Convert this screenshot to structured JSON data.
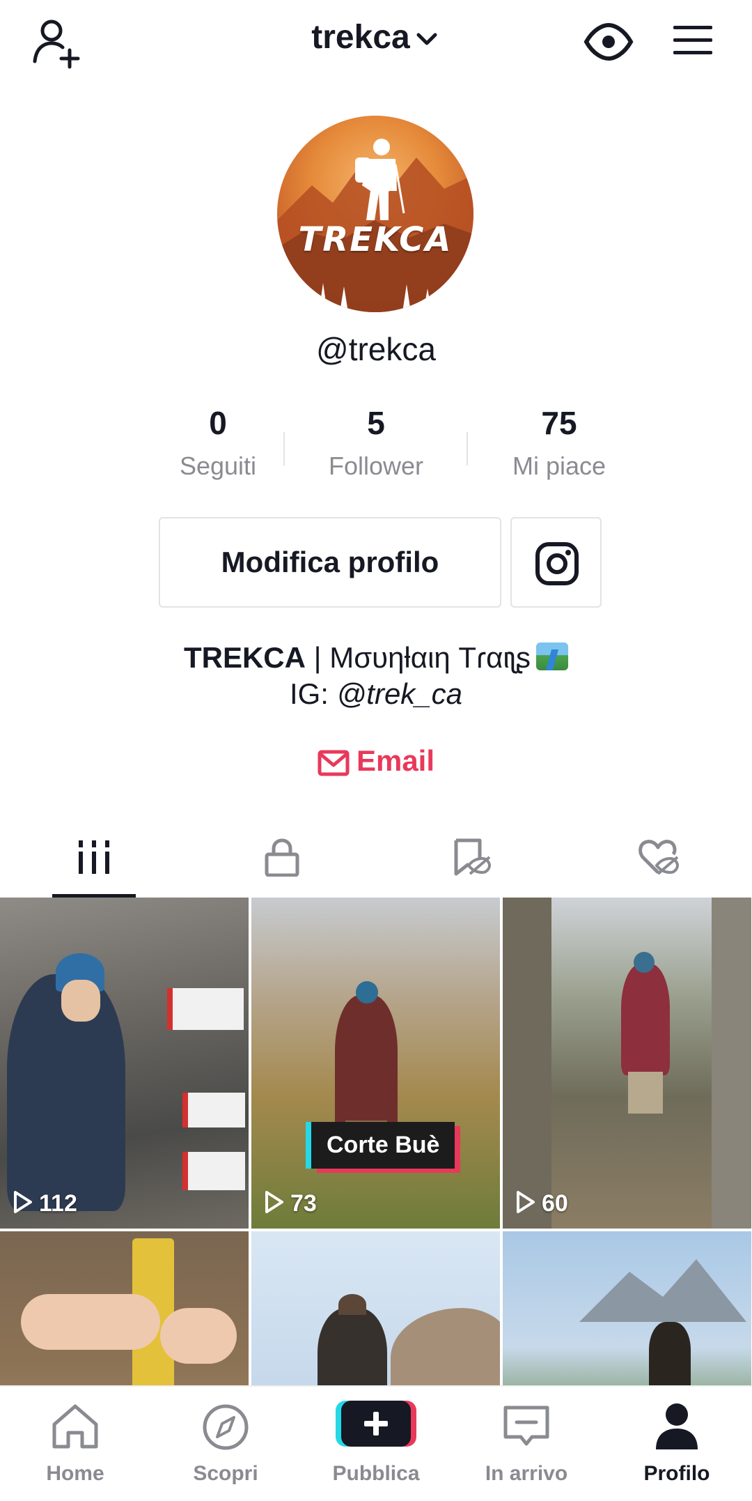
{
  "header": {
    "username": "trekca"
  },
  "profile": {
    "avatar_text": "TREKCA",
    "handle": "@trekca",
    "stats": [
      {
        "value": "0",
        "label": "Seguiti"
      },
      {
        "value": "5",
        "label": "Follower"
      },
      {
        "value": "75",
        "label": "Mi piace"
      }
    ],
    "edit_button": "Modifica profilo",
    "bio": {
      "name": "TREKCA",
      "separator": " | ",
      "tagline": "Mσυηƚαιη Tɾαιʅʂ",
      "ig_prefix": "IG: ",
      "ig_handle": "@trek_ca"
    },
    "email_label": "Email",
    "accent_color": "#e8395b"
  },
  "tabs": [
    "videos-grid",
    "private",
    "reposts-hidden",
    "liked-hidden"
  ],
  "videos": [
    {
      "views": "112",
      "caption": ""
    },
    {
      "views": "73",
      "caption": "Corte Buè"
    },
    {
      "views": "60",
      "caption": ""
    },
    {
      "views": "",
      "caption": ""
    },
    {
      "views": "",
      "caption": ""
    },
    {
      "views": "",
      "caption": ""
    }
  ],
  "nav": [
    {
      "label": "Home",
      "icon": "home-icon"
    },
    {
      "label": "Scopri",
      "icon": "compass-icon"
    },
    {
      "label": "Pubblica",
      "icon": "plus-icon"
    },
    {
      "label": "In arrivo",
      "icon": "inbox-icon"
    },
    {
      "label": "Profilo",
      "icon": "profile-icon",
      "active": true
    }
  ]
}
